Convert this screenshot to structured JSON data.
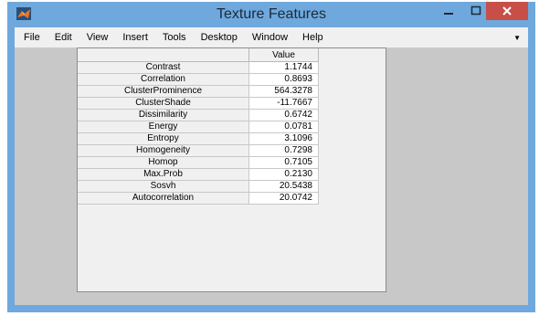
{
  "window": {
    "title": "Texture Features",
    "controls": {
      "minimize_icon": "minimize-icon",
      "maximize_icon": "maximize-icon",
      "close_icon": "close-icon"
    },
    "colors": {
      "titlebar": "#6fa8dc",
      "close": "#c74f48",
      "figure_bg": "#c8c8c8"
    }
  },
  "menubar": {
    "items": [
      "File",
      "Edit",
      "View",
      "Insert",
      "Tools",
      "Desktop",
      "Window",
      "Help"
    ],
    "overflow_icon": "chevron-down-icon"
  },
  "table": {
    "column_header": "Value",
    "rows": [
      {
        "name": "Contrast",
        "value": "1.1744"
      },
      {
        "name": "Correlation",
        "value": "0.8693"
      },
      {
        "name": "ClusterProminence",
        "value": "564.3278"
      },
      {
        "name": "ClusterShade",
        "value": "-11.7667"
      },
      {
        "name": "Dissimilarity",
        "value": "0.6742"
      },
      {
        "name": "Energy",
        "value": "0.0781"
      },
      {
        "name": "Entropy",
        "value": "3.1096"
      },
      {
        "name": "Homogeneity",
        "value": "0.7298"
      },
      {
        "name": "Homop",
        "value": "0.7105"
      },
      {
        "name": "Max.Prob",
        "value": "0.2130"
      },
      {
        "name": "Sosvh",
        "value": "20.5438"
      },
      {
        "name": "Autocorrelation",
        "value": "20.0742"
      }
    ]
  }
}
